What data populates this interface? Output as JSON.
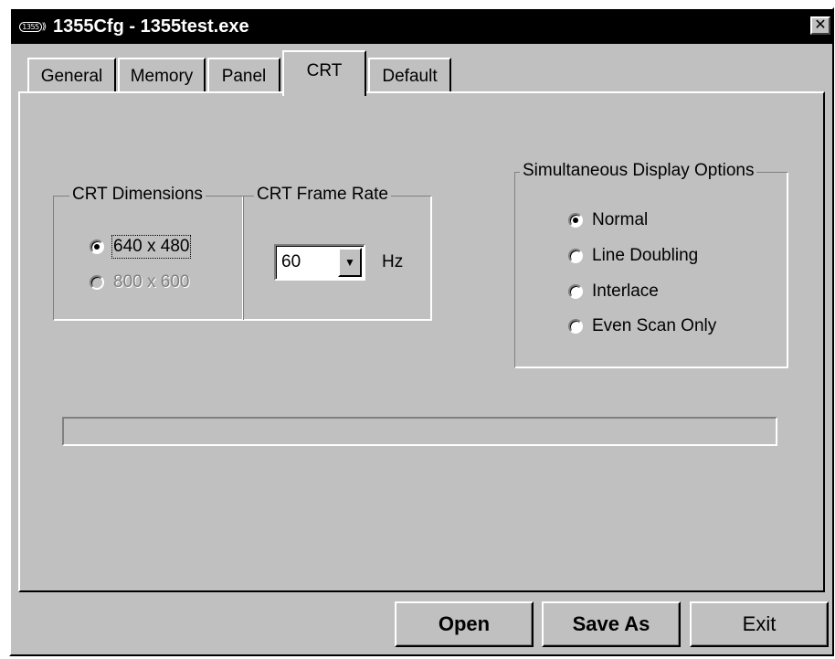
{
  "window": {
    "title": "1355Cfg - 1355test.exe",
    "icon_text": "1355",
    "close_symbol": "✕"
  },
  "tabs": [
    {
      "label": "General",
      "active": false
    },
    {
      "label": "Memory",
      "active": false
    },
    {
      "label": "Panel",
      "active": false
    },
    {
      "label": "CRT",
      "active": true
    },
    {
      "label": "Default",
      "active": false
    }
  ],
  "crt_dimensions": {
    "legend": "CRT Dimensions",
    "options": [
      {
        "label": "640 x 480",
        "checked": true,
        "enabled": true
      },
      {
        "label": "800 x 600",
        "checked": false,
        "enabled": false
      }
    ]
  },
  "crt_frame_rate": {
    "legend": "CRT Frame Rate",
    "value": "60",
    "unit": "Hz"
  },
  "simultaneous_display": {
    "legend": "Simultaneous Display Options",
    "options": [
      {
        "label": "Normal",
        "checked": true
      },
      {
        "label": "Line Doubling",
        "checked": false
      },
      {
        "label": "Interlace",
        "checked": false
      },
      {
        "label": "Even Scan Only",
        "checked": false
      }
    ]
  },
  "buttons": {
    "open": "Open",
    "save_as": "Save As",
    "exit": "Exit"
  },
  "colors": {
    "face": "#c0c0c0",
    "titlebar": "#000000"
  }
}
